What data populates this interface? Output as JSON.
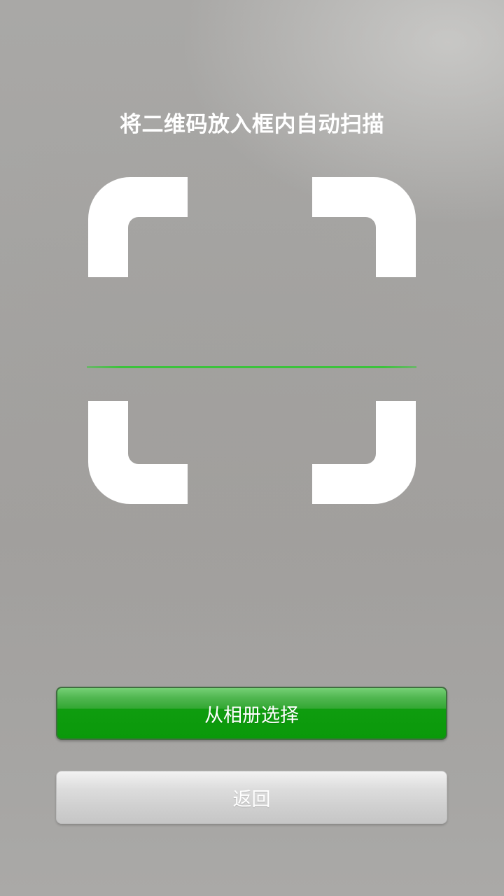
{
  "instruction": "将二维码放入框内自动扫描",
  "buttons": {
    "album_label": "从相册选择",
    "back_label": "返回"
  },
  "colors": {
    "scan_line": "#3cc33c",
    "primary_button": "#0a990a",
    "frame": "#ffffff"
  },
  "icons": {
    "frame_corners": [
      "corner-top-left-icon",
      "corner-top-right-icon",
      "corner-bottom-left-icon",
      "corner-bottom-right-icon"
    ]
  }
}
